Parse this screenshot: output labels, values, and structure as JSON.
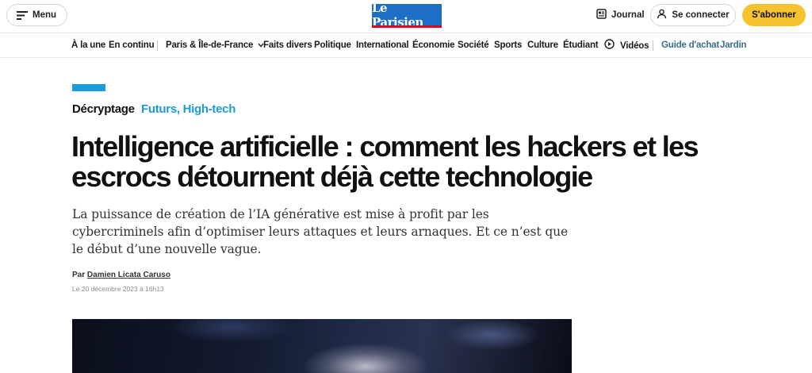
{
  "header": {
    "menu_label": "Menu",
    "logo_text": "Le Parisien",
    "journal_label": "Journal",
    "signin_label": "Se connecter",
    "subscribe_label": "S'abonner"
  },
  "nav": {
    "items": [
      "À la une",
      "En continu",
      "Paris & Île-de-France",
      "Faits divers",
      "Politique",
      "International",
      "Économie",
      "Société",
      "Sports",
      "Culture",
      "Étudiant",
      "Vidéos"
    ],
    "secondary": [
      "Guide d'achat",
      "Jardin"
    ]
  },
  "article": {
    "kicker": "Décryptage",
    "category": "Futurs, High-tech",
    "headline": "Intelligence artificielle : comment les hackers et les escrocs détournent déjà cette technologie",
    "chapo": "La puissance de création de l’IA générative est mise à profit par les cybercriminels afin d’optimiser leurs attaques et leurs arnaques. Et ce n’est que le début d’une nouvelle vague.",
    "byline_prefix": "Par",
    "author": "Damien Licata Caruso",
    "date": "Le 20 décembre 2023 à 16h13"
  },
  "colors": {
    "accent_blue": "#1d9bd8",
    "logo_blue": "#1c6ec7",
    "subscribe_yellow": "#f6c32f",
    "secondary_nav": "#3a6d8c"
  }
}
